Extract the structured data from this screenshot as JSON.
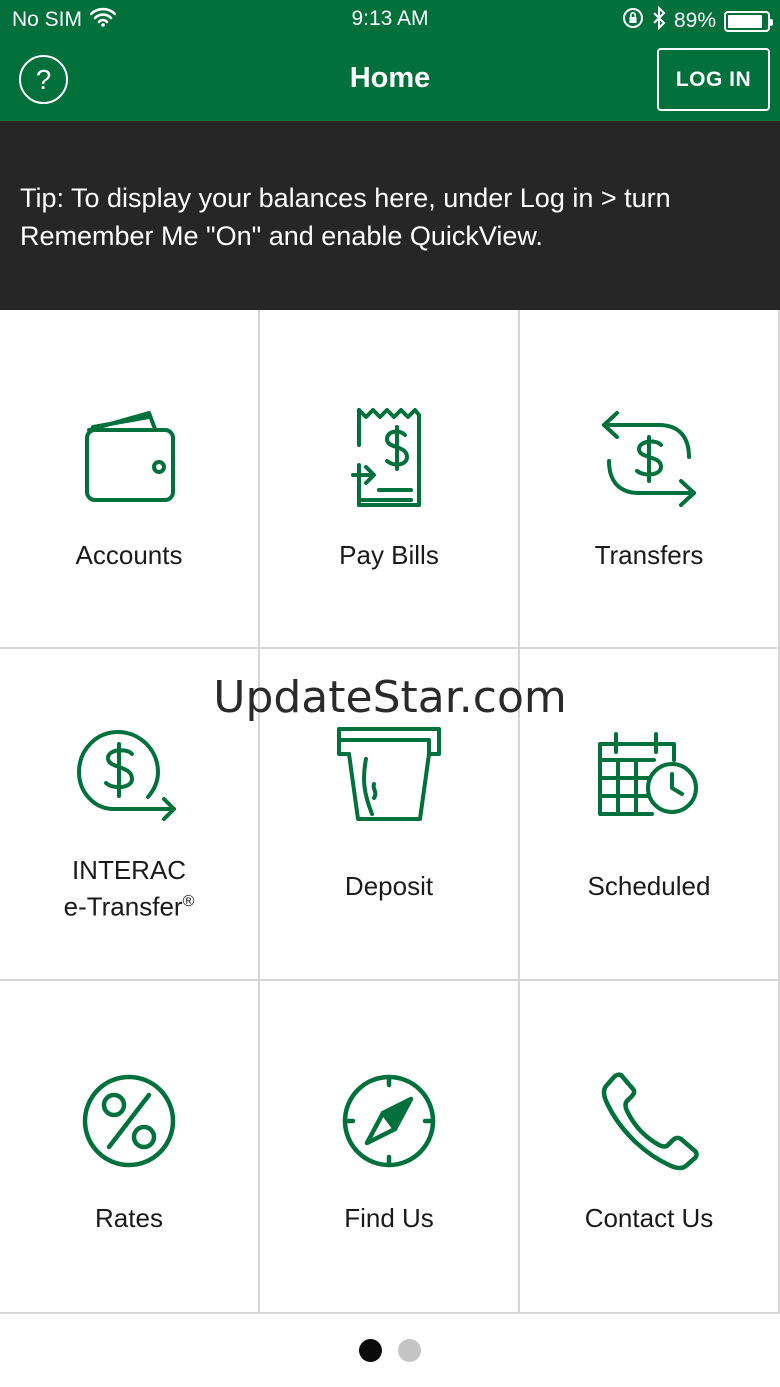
{
  "status_bar": {
    "carrier": "No SIM",
    "time": "9:13 AM",
    "battery_percent": "89%",
    "battery_level": 0.89
  },
  "header": {
    "title": "Home",
    "login_label": "LOG IN",
    "help_glyph": "?"
  },
  "tip": {
    "text": "Tip: To display your balances here, under Log in > turn Remember Me \"On\" and enable QuickView."
  },
  "tiles": [
    {
      "label": "Accounts",
      "icon": "wallet-icon"
    },
    {
      "label": "Pay Bills",
      "icon": "bill-icon"
    },
    {
      "label": "Transfers",
      "icon": "transfer-icon"
    },
    {
      "label_line1": "INTERAC",
      "label_line2": "e-Transfer",
      "label_sup": "®",
      "icon": "e-transfer-icon"
    },
    {
      "label": "Deposit",
      "icon": "deposit-icon"
    },
    {
      "label": "Scheduled",
      "icon": "calendar-clock-icon"
    },
    {
      "label": "Rates",
      "icon": "percent-icon"
    },
    {
      "label": "Find Us",
      "icon": "compass-icon"
    },
    {
      "label": "Contact Us",
      "icon": "phone-icon"
    }
  ],
  "watermark": "UpdateStar.com",
  "pager": {
    "pages": 2,
    "active": 1
  },
  "colors": {
    "brand_green": "#02703b",
    "tip_bg": "#262626",
    "icon_green": "#00703c"
  }
}
